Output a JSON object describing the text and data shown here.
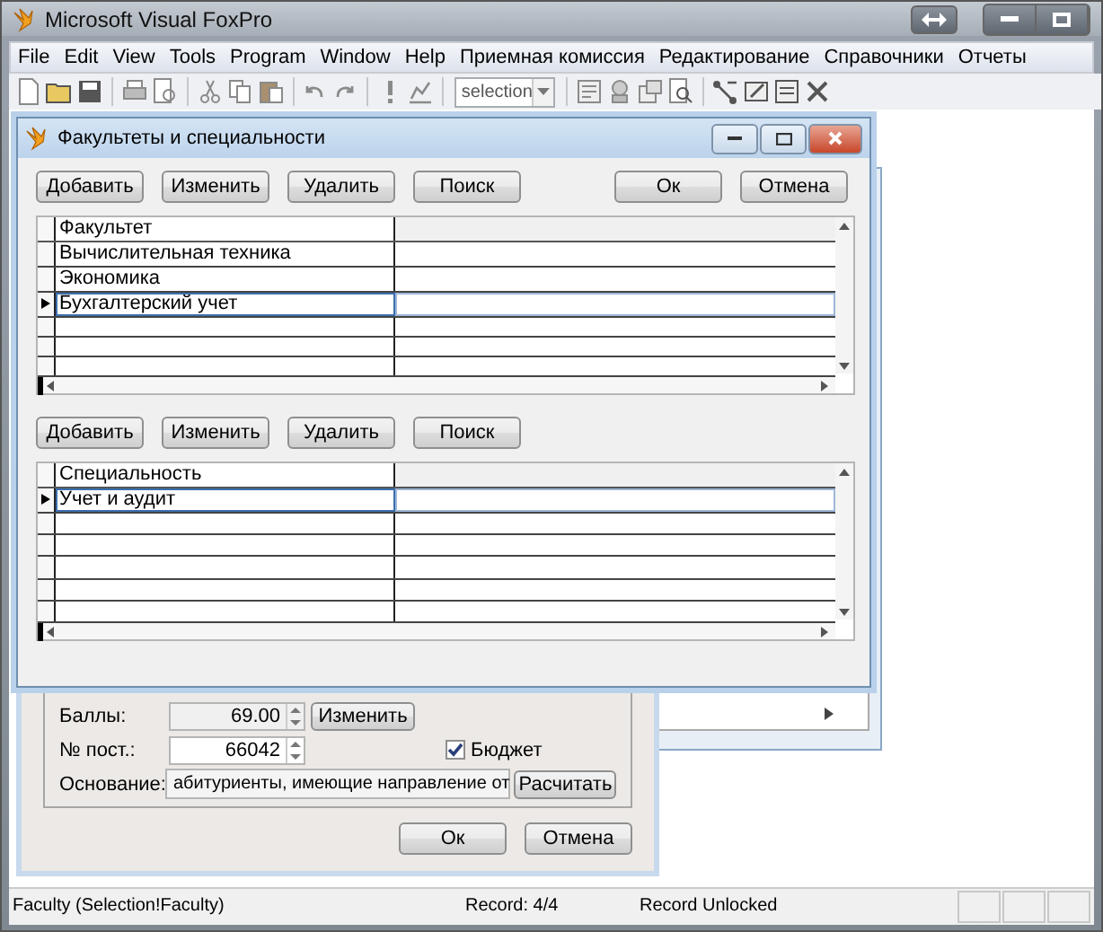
{
  "window": {
    "title": "Microsoft Visual FoxPro"
  },
  "menu": [
    {
      "label": "File"
    },
    {
      "label": "Edit"
    },
    {
      "label": "View"
    },
    {
      "label": "Tools"
    },
    {
      "label": "Program"
    },
    {
      "label": "Window"
    },
    {
      "label": "Help"
    },
    {
      "label": "Приемная комиссия"
    },
    {
      "label": "Редактирование"
    },
    {
      "label": "Справочники"
    },
    {
      "label": "Отчеты"
    }
  ],
  "toolbar": {
    "combo": {
      "value": "selection"
    }
  },
  "back_dialog": {
    "fields": [
      {
        "label": "Баллы:",
        "value": "69.00",
        "disabled": true
      },
      {
        "label": "№ пост.:",
        "value": "66042",
        "disabled": false
      }
    ],
    "change_button": "Изменить",
    "checkbox": {
      "label": "Бюджет",
      "checked": true
    },
    "basis": {
      "label": "Основание:",
      "value": "абитуриенты, имеющие направление от"
    },
    "calc_button": "Расчитать",
    "buttons": [
      "Ок",
      "Отмена"
    ]
  },
  "dialog": {
    "title": "Факультеты и специальности",
    "faculty_buttons": [
      "Добавить",
      "Изменить",
      "Удалить",
      "Поиск"
    ],
    "right_buttons": [
      "Ок",
      "Отмена"
    ],
    "faculty_grid": {
      "columns": [
        "Факультет"
      ],
      "rows": [
        {
          "cells": [
            "Вычислительная техника"
          ],
          "selected": false
        },
        {
          "cells": [
            "Экономика"
          ],
          "selected": false
        },
        {
          "cells": [
            "Бухгалтерский учет"
          ],
          "selected": true
        }
      ]
    },
    "specialty_buttons": [
      "Добавить",
      "Изменить",
      "Удалить",
      "Поиск"
    ],
    "specialty_grid": {
      "columns": [
        "Специальность"
      ],
      "rows": [
        {
          "cells": [
            "Учет и аудит"
          ],
          "selected": true
        }
      ]
    }
  },
  "status_bar": [
    "Faculty (Selection!Faculty)",
    "Record: 4/4",
    "Record Unlocked"
  ]
}
